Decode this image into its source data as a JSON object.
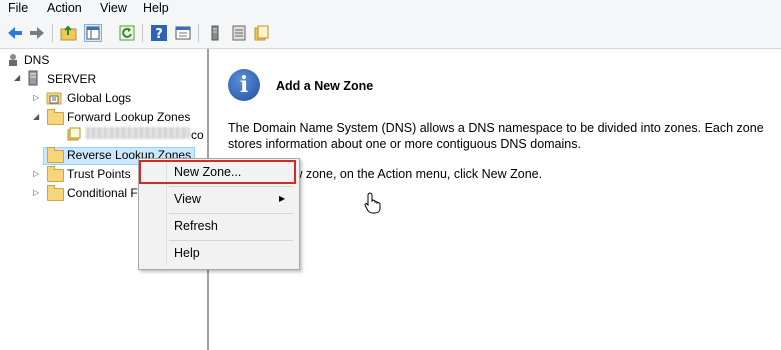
{
  "menu": {
    "file": "File",
    "action": "Action",
    "view": "View",
    "help": "Help"
  },
  "toolbar": {
    "icons": [
      "back-arrow-icon",
      "forward-arrow-icon",
      "up-folder-icon",
      "console-tree-icon",
      "refresh-icon",
      "help-icon",
      "properties-icon",
      "server-icon",
      "list-icon",
      "zone-icon"
    ]
  },
  "tree": {
    "root": "DNS",
    "server": "SERVER",
    "global_logs": "Global Logs",
    "forward_zones": "Forward Lookup Zones",
    "zone_suffix": "co",
    "reverse_zones": "Reverse Lookup Zones",
    "trust_points": "Trust Points",
    "conditional": "Conditional F"
  },
  "main": {
    "heading": "Add a New Zone",
    "line1": "The Domain Name System (DNS) allows a DNS namespace to be divided into zones. Each zone",
    "line2": "stores information about one or more contiguous DNS domains.",
    "line3": "To add a new zone, on the Action menu, click New Zone."
  },
  "context_menu": {
    "new_zone": "New Zone...",
    "view": "View",
    "refresh": "Refresh",
    "help": "Help"
  },
  "colors": {
    "selection": "#cce8ff",
    "highlight_border": "#d02a2a",
    "info_blue": "#1f4fa0"
  }
}
